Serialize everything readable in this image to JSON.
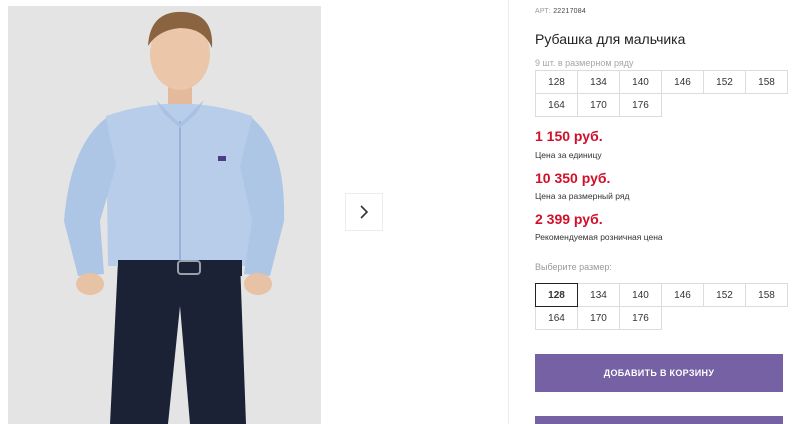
{
  "product": {
    "article_label": "АРТ:",
    "article_value": "22217084",
    "title": "Рубашка для мальчика",
    "range_label": "9 шт. в размерном ряду",
    "range_sizes": [
      "128",
      "134",
      "140",
      "146",
      "152",
      "158",
      "164",
      "170",
      "176"
    ]
  },
  "prices": [
    {
      "value": "1 150 руб.",
      "note": "Цена за единицу"
    },
    {
      "value": "10 350 руб.",
      "note": "Цена за размерный ряд"
    },
    {
      "value": "2 399 руб.",
      "note": "Рекомендуемая розничная цена"
    }
  ],
  "size_select": {
    "label": "Выберите размер:",
    "options": [
      "128",
      "134",
      "140",
      "146",
      "152",
      "158",
      "164",
      "170",
      "176"
    ],
    "selected": "128"
  },
  "cart_button": {
    "label": "ДОБАВИТЬ В КОРЗИНУ"
  },
  "gallery": {
    "next_icon": "chevron-right-icon"
  },
  "colors": {
    "accent": "#7561a4",
    "price": "#d0102a"
  }
}
